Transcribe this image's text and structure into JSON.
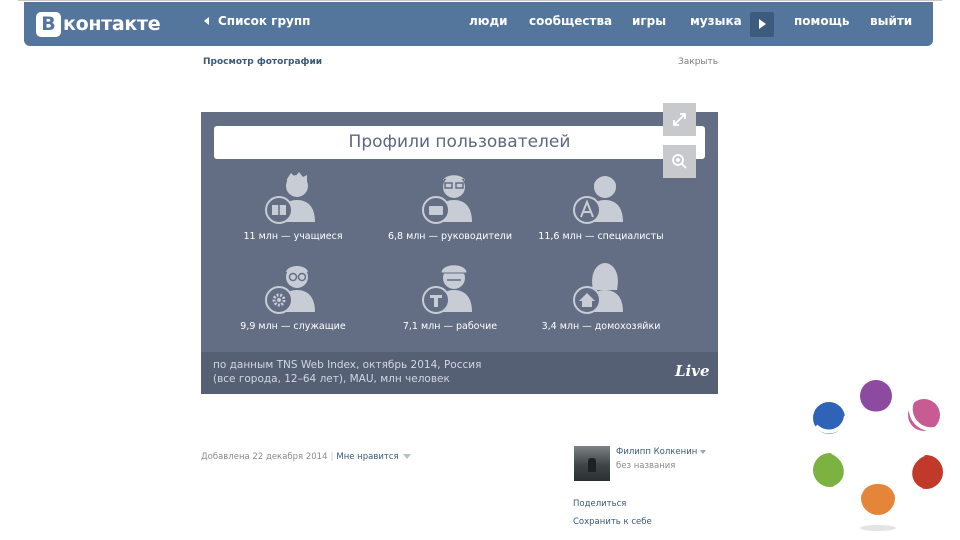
{
  "header": {
    "logo_letter": "В",
    "logo_text": "контакте",
    "back_label": "Список групп",
    "nav": [
      {
        "label": "люди"
      },
      {
        "label": "сообщества"
      },
      {
        "label": "игры"
      },
      {
        "label": "музыка"
      },
      {
        "label": "помощь"
      },
      {
        "label": "выйти"
      }
    ],
    "brand_color": "#54769c"
  },
  "viewer": {
    "title": "Просмотр фотографии",
    "close_label": "Закрыть"
  },
  "photo": {
    "title": "Профили пользователей",
    "profiles": [
      {
        "caption": "11 млн — учащиеся",
        "icon": "student-icon"
      },
      {
        "caption": "6,8 млн — руководители",
        "icon": "manager-icon"
      },
      {
        "caption": "11,6 млн — специалисты",
        "icon": "specialist-icon"
      },
      {
        "caption": "9,9 млн — служащие",
        "icon": "employee-icon"
      },
      {
        "caption": "7,1 млн — рабочие",
        "icon": "worker-icon"
      },
      {
        "caption": "3,4 млн — домохозяйки",
        "icon": "housewife-icon"
      }
    ],
    "source_line1": "по данным TNS Web Index, октябрь 2014, Россия",
    "source_line2": "(все города, 12–64 лет), MAU, млн человек",
    "brand": "Live",
    "background": "#636d83"
  },
  "tools": {
    "expand_icon": "expand-icon",
    "zoom_icon": "zoom-icon"
  },
  "info": {
    "added": "Добавлена 22 декабря 2014",
    "like_label": "Мне нравится",
    "author_name": "Филипп Колкенин",
    "album": "без названия",
    "share_label": "Поделиться",
    "save_label": "Сохранить к себе"
  }
}
